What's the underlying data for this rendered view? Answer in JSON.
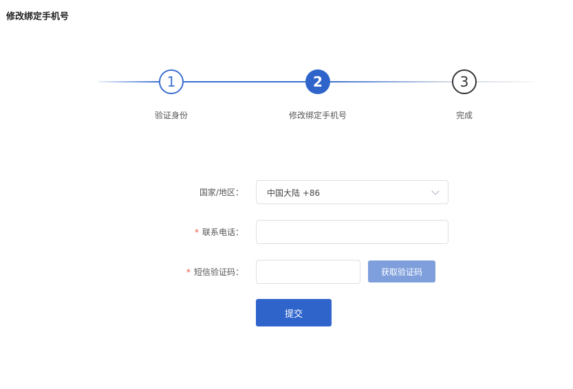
{
  "page": {
    "title": "修改绑定手机号"
  },
  "steps": [
    {
      "number": "1",
      "label": "验证身份",
      "state": "done"
    },
    {
      "number": "2",
      "label": "修改绑定手机号",
      "state": "active"
    },
    {
      "number": "3",
      "label": "完成",
      "state": "pending"
    }
  ],
  "form": {
    "country": {
      "label": "国家/地区：",
      "value": "中国大陆 +86"
    },
    "phone": {
      "required_mark": "*",
      "label": "联系电话：",
      "value": ""
    },
    "sms": {
      "required_mark": "*",
      "label": "短信验证码：",
      "value": "",
      "get_code_label": "获取验证码"
    },
    "submit_label": "提交"
  },
  "colors": {
    "primary": "#2f65cb",
    "primary_light": "#7f9fdc",
    "required": "#e4573f"
  }
}
